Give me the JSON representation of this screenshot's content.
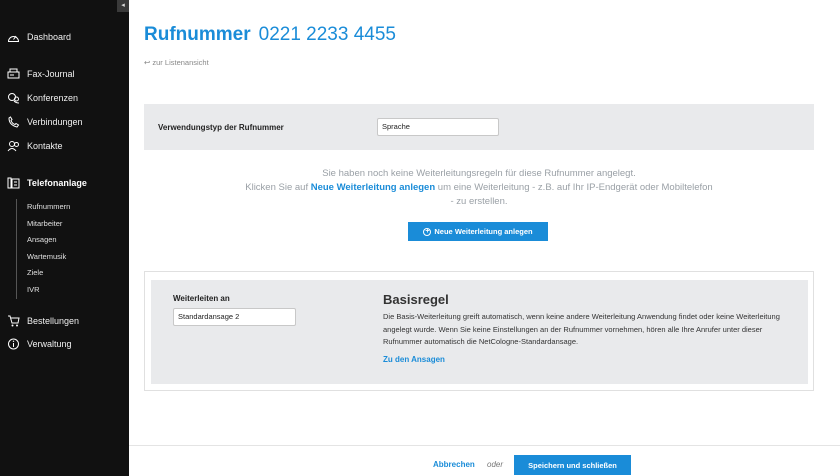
{
  "sidebar": {
    "collapse_glyph": "◂",
    "items": [
      {
        "label": "Dashboard",
        "icon": "dashboard-gauge-icon"
      },
      {
        "label": "Fax-Journal",
        "icon": "fax-icon"
      },
      {
        "label": "Konferenzen",
        "icon": "conference-icon"
      },
      {
        "label": "Verbindungen",
        "icon": "phone-icon"
      },
      {
        "label": "Kontakte",
        "icon": "contacts-icon"
      },
      {
        "label": "Telefonanlage",
        "icon": "pbx-icon"
      },
      {
        "label": "Bestellungen",
        "icon": "cart-icon"
      },
      {
        "label": "Verwaltung",
        "icon": "info-icon"
      }
    ],
    "subitems": [
      {
        "label": "Rufnummern"
      },
      {
        "label": "Mitarbeiter"
      },
      {
        "label": "Ansagen"
      },
      {
        "label": "Wartemusik"
      },
      {
        "label": "Ziele"
      },
      {
        "label": "IVR"
      }
    ]
  },
  "header": {
    "title": "Rufnummer",
    "number": "0221 2233 4455",
    "back_link": "zur Listenansicht"
  },
  "type_panel": {
    "label": "Verwendungstyp der Rufnummer",
    "value": "Sprache"
  },
  "info": {
    "line1": "Sie haben noch keine Weiterleitungsregeln für diese Rufnummer angelegt.",
    "line2_prefix": "Klicken Sie auf",
    "line2_link": "Neue Weiterleitung anlegen",
    "line2_suffix": "um eine Weiterleitung - z.B. auf Ihr IP-Endgerät oder Mobiltelefon",
    "line3": "- zu erstellen."
  },
  "new_forward_button": "Neue Weiterleitung anlegen",
  "rule": {
    "forward_label": "Weiterleiten an",
    "forward_value": "Standardansage 2",
    "title": "Basisregel",
    "description": "Die Basis-Weiterleitung greift automatisch, wenn keine andere Weiterleitung Anwendung findet oder keine Weiterleitung angelegt wurde. Wenn Sie keine Einstellungen an der Rufnummer vornehmen, hören alle Ihre Anrufer unter dieser Rufnummer automatisch die NetCologne-Standardansage.",
    "link": "Zu den Ansagen"
  },
  "footer": {
    "cancel": "Abbrechen",
    "or": "oder",
    "save": "Speichern und schließen"
  },
  "colors": {
    "accent": "#1a8cd8",
    "sidebar_bg": "#111111",
    "panel_bg": "#e9eaec"
  }
}
